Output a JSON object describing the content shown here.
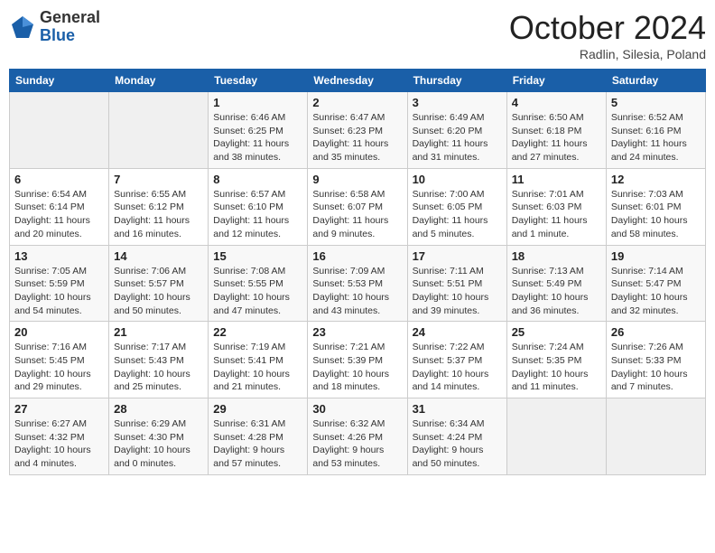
{
  "logo": {
    "general": "General",
    "blue": "Blue"
  },
  "header": {
    "month": "October 2024",
    "location": "Radlin, Silesia, Poland"
  },
  "weekdays": [
    "Sunday",
    "Monday",
    "Tuesday",
    "Wednesday",
    "Thursday",
    "Friday",
    "Saturday"
  ],
  "weeks": [
    [
      {
        "day": "",
        "info": ""
      },
      {
        "day": "",
        "info": ""
      },
      {
        "day": "1",
        "info": "Sunrise: 6:46 AM\nSunset: 6:25 PM\nDaylight: 11 hours and 38 minutes."
      },
      {
        "day": "2",
        "info": "Sunrise: 6:47 AM\nSunset: 6:23 PM\nDaylight: 11 hours and 35 minutes."
      },
      {
        "day": "3",
        "info": "Sunrise: 6:49 AM\nSunset: 6:20 PM\nDaylight: 11 hours and 31 minutes."
      },
      {
        "day": "4",
        "info": "Sunrise: 6:50 AM\nSunset: 6:18 PM\nDaylight: 11 hours and 27 minutes."
      },
      {
        "day": "5",
        "info": "Sunrise: 6:52 AM\nSunset: 6:16 PM\nDaylight: 11 hours and 24 minutes."
      }
    ],
    [
      {
        "day": "6",
        "info": "Sunrise: 6:54 AM\nSunset: 6:14 PM\nDaylight: 11 hours and 20 minutes."
      },
      {
        "day": "7",
        "info": "Sunrise: 6:55 AM\nSunset: 6:12 PM\nDaylight: 11 hours and 16 minutes."
      },
      {
        "day": "8",
        "info": "Sunrise: 6:57 AM\nSunset: 6:10 PM\nDaylight: 11 hours and 12 minutes."
      },
      {
        "day": "9",
        "info": "Sunrise: 6:58 AM\nSunset: 6:07 PM\nDaylight: 11 hours and 9 minutes."
      },
      {
        "day": "10",
        "info": "Sunrise: 7:00 AM\nSunset: 6:05 PM\nDaylight: 11 hours and 5 minutes."
      },
      {
        "day": "11",
        "info": "Sunrise: 7:01 AM\nSunset: 6:03 PM\nDaylight: 11 hours and 1 minute."
      },
      {
        "day": "12",
        "info": "Sunrise: 7:03 AM\nSunset: 6:01 PM\nDaylight: 10 hours and 58 minutes."
      }
    ],
    [
      {
        "day": "13",
        "info": "Sunrise: 7:05 AM\nSunset: 5:59 PM\nDaylight: 10 hours and 54 minutes."
      },
      {
        "day": "14",
        "info": "Sunrise: 7:06 AM\nSunset: 5:57 PM\nDaylight: 10 hours and 50 minutes."
      },
      {
        "day": "15",
        "info": "Sunrise: 7:08 AM\nSunset: 5:55 PM\nDaylight: 10 hours and 47 minutes."
      },
      {
        "day": "16",
        "info": "Sunrise: 7:09 AM\nSunset: 5:53 PM\nDaylight: 10 hours and 43 minutes."
      },
      {
        "day": "17",
        "info": "Sunrise: 7:11 AM\nSunset: 5:51 PM\nDaylight: 10 hours and 39 minutes."
      },
      {
        "day": "18",
        "info": "Sunrise: 7:13 AM\nSunset: 5:49 PM\nDaylight: 10 hours and 36 minutes."
      },
      {
        "day": "19",
        "info": "Sunrise: 7:14 AM\nSunset: 5:47 PM\nDaylight: 10 hours and 32 minutes."
      }
    ],
    [
      {
        "day": "20",
        "info": "Sunrise: 7:16 AM\nSunset: 5:45 PM\nDaylight: 10 hours and 29 minutes."
      },
      {
        "day": "21",
        "info": "Sunrise: 7:17 AM\nSunset: 5:43 PM\nDaylight: 10 hours and 25 minutes."
      },
      {
        "day": "22",
        "info": "Sunrise: 7:19 AM\nSunset: 5:41 PM\nDaylight: 10 hours and 21 minutes."
      },
      {
        "day": "23",
        "info": "Sunrise: 7:21 AM\nSunset: 5:39 PM\nDaylight: 10 hours and 18 minutes."
      },
      {
        "day": "24",
        "info": "Sunrise: 7:22 AM\nSunset: 5:37 PM\nDaylight: 10 hours and 14 minutes."
      },
      {
        "day": "25",
        "info": "Sunrise: 7:24 AM\nSunset: 5:35 PM\nDaylight: 10 hours and 11 minutes."
      },
      {
        "day": "26",
        "info": "Sunrise: 7:26 AM\nSunset: 5:33 PM\nDaylight: 10 hours and 7 minutes."
      }
    ],
    [
      {
        "day": "27",
        "info": "Sunrise: 6:27 AM\nSunset: 4:32 PM\nDaylight: 10 hours and 4 minutes."
      },
      {
        "day": "28",
        "info": "Sunrise: 6:29 AM\nSunset: 4:30 PM\nDaylight: 10 hours and 0 minutes."
      },
      {
        "day": "29",
        "info": "Sunrise: 6:31 AM\nSunset: 4:28 PM\nDaylight: 9 hours and 57 minutes."
      },
      {
        "day": "30",
        "info": "Sunrise: 6:32 AM\nSunset: 4:26 PM\nDaylight: 9 hours and 53 minutes."
      },
      {
        "day": "31",
        "info": "Sunrise: 6:34 AM\nSunset: 4:24 PM\nDaylight: 9 hours and 50 minutes."
      },
      {
        "day": "",
        "info": ""
      },
      {
        "day": "",
        "info": ""
      }
    ]
  ]
}
